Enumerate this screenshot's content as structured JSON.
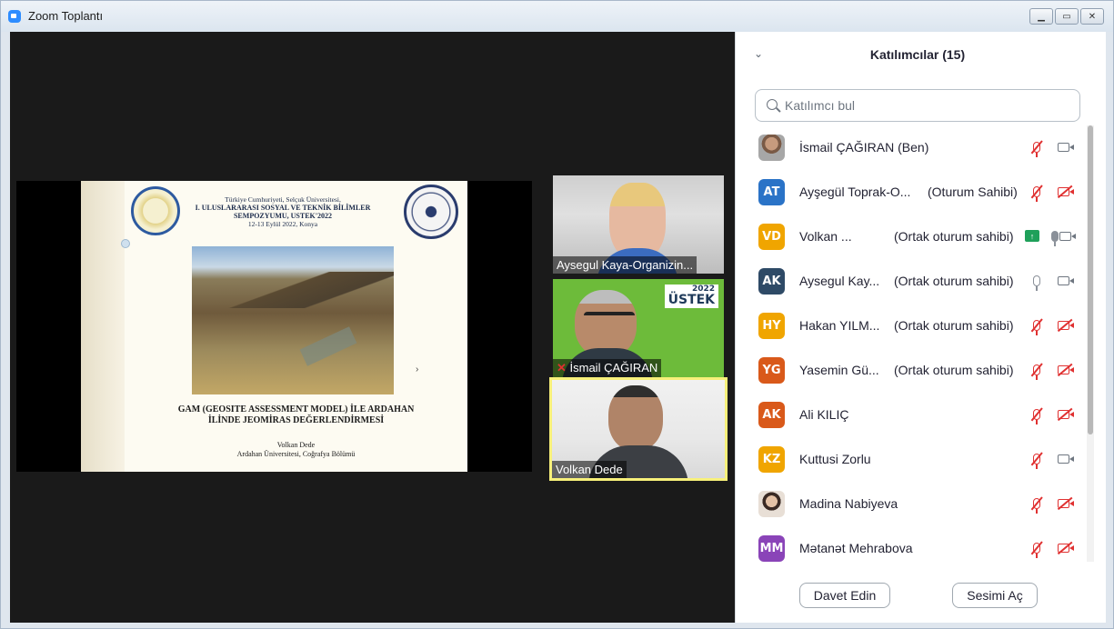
{
  "window": {
    "title": "Zoom Toplantı",
    "controls": [
      "minimize",
      "maximize",
      "close"
    ]
  },
  "slide": {
    "header_line1": "Türkiye Cumhuriyeti, Selçuk Üniversitesi,",
    "header_line2": "I. ULUSLARARASI SOSYAL VE TEKNİK BİLİMLER",
    "header_line3": "SEMPOZYUMU, USTEK'2022",
    "header_line4": "12-13 Eylül 2022, Konya",
    "title_line1": "GAM (GEOSITE ASSESSMENT MODEL) İLE ARDAHAN",
    "title_line2": "İLİNDE JEOMİRAS DEĞERLENDİRMESİ",
    "author": "Volkan Dede",
    "affiliation": "Ardahan Üniversitesi, Coğrafya Bölümü"
  },
  "tiles": [
    {
      "name": "Aysegul Kaya-Organizin...",
      "muted": false
    },
    {
      "name": "İsmail ÇAĞIRAN",
      "muted": true,
      "logo": "ÜSTEK",
      "logo_year": "2022"
    },
    {
      "name": "Volkan Dede",
      "muted": false,
      "active_speaker": true
    }
  ],
  "panel": {
    "title": "Katılımcılar (15)",
    "search_placeholder": "Katılımcı bul",
    "invite_label": "Davet Edin",
    "unmute_label": "Sesimi Aç"
  },
  "participants": [
    {
      "initials": "",
      "avatar": "photo-man",
      "name": "İsmail ÇAĞIRAN (Ben)",
      "role": "",
      "mic": "muted",
      "cam": "on",
      "color": "#8a6a55"
    },
    {
      "initials": "AT",
      "avatar": "initials",
      "name": "Ayşegül Toprak-O...",
      "role": "(Oturum Sahibi)",
      "mic": "muted",
      "cam": "off",
      "color": "#2a73c7"
    },
    {
      "initials": "VD",
      "avatar": "initials",
      "name": "Volkan ...",
      "role": "(Ortak oturum sahibi)",
      "mic": "speaking",
      "cam": "on",
      "sharing": true,
      "color": "#f0a500"
    },
    {
      "initials": "AK",
      "avatar": "initials",
      "name": "Aysegul Kay...",
      "role": "(Ortak oturum sahibi)",
      "mic": "on",
      "cam": "on",
      "color": "#2e4a66"
    },
    {
      "initials": "HY",
      "avatar": "initials",
      "name": "Hakan YILM...",
      "role": "(Ortak oturum sahibi)",
      "mic": "muted",
      "cam": "off",
      "color": "#f0a500"
    },
    {
      "initials": "YG",
      "avatar": "initials",
      "name": "Yasemin Gü...",
      "role": "(Ortak oturum sahibi)",
      "mic": "muted",
      "cam": "off",
      "color": "#d9591a"
    },
    {
      "initials": "AK",
      "avatar": "initials",
      "name": "Ali KILIÇ",
      "role": "",
      "mic": "muted",
      "cam": "off",
      "color": "#d9591a"
    },
    {
      "initials": "KZ",
      "avatar": "initials",
      "name": "Kuttusi Zorlu",
      "role": "",
      "mic": "muted",
      "cam": "on",
      "color": "#f0a500"
    },
    {
      "initials": "",
      "avatar": "photo-woman",
      "name": "Madina Nabiyeva",
      "role": "",
      "mic": "muted",
      "cam": "off",
      "color": "#d8b28a"
    },
    {
      "initials": "MM",
      "avatar": "initials",
      "name": "Mətanət Mehrabova",
      "role": "",
      "mic": "muted",
      "cam": "off",
      "color": "#8a44b8"
    }
  ],
  "colors": {
    "accent": "#2d8cff",
    "muted_red": "#e03131",
    "share_green": "#1fa05a",
    "active_speaker_border": "#f7f07a"
  }
}
